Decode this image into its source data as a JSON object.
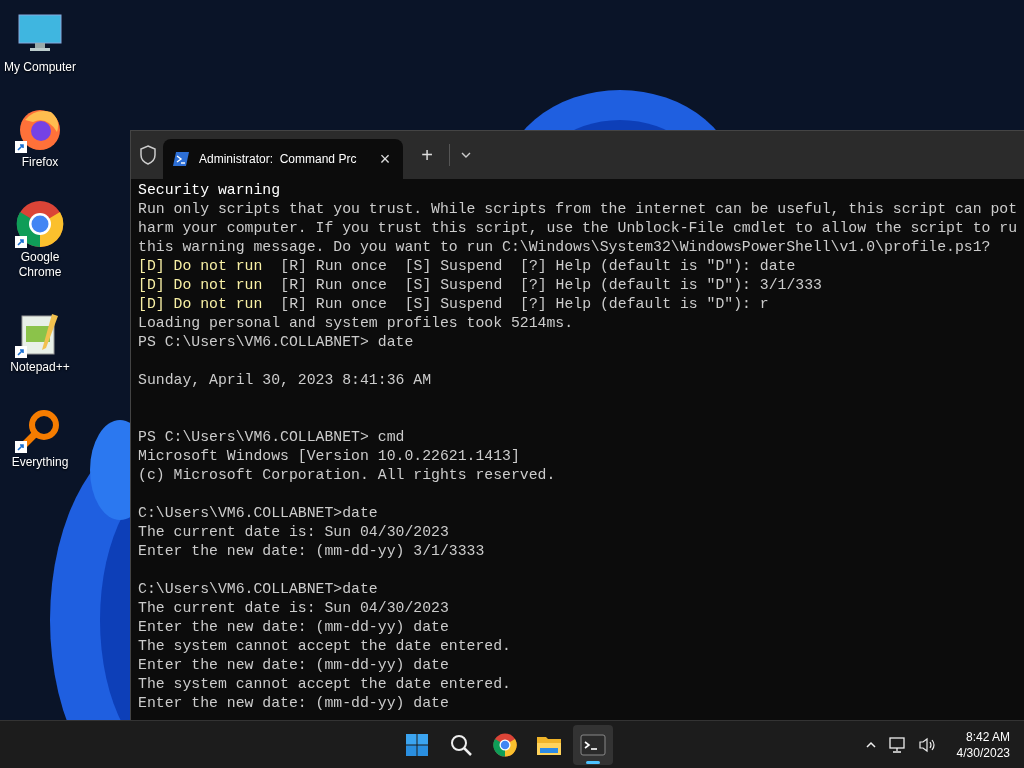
{
  "desktop_icons": [
    {
      "label": "My Computer",
      "kind": "monitor",
      "shortcut": false
    },
    {
      "label": "Firefox",
      "kind": "firefox",
      "shortcut": true
    },
    {
      "label": "Google Chrome",
      "kind": "chrome",
      "shortcut": true
    },
    {
      "label": "Notepad++",
      "kind": "notepad",
      "shortcut": true
    },
    {
      "label": "Everything",
      "kind": "everything",
      "shortcut": true
    }
  ],
  "terminal": {
    "tabs": [
      {
        "title": "Administrator:  Command Prc",
        "close": "×",
        "selected": true
      }
    ],
    "new_tab": "+",
    "lines": [
      {
        "kind": "heading",
        "text": "Security warning"
      },
      {
        "kind": "text",
        "text": "Run only scripts that you trust. While scripts from the internet can be useful, this script can pot"
      },
      {
        "kind": "text",
        "text": "harm your computer. If you trust this script, use the Unblock-File cmdlet to allow the script to ru"
      },
      {
        "kind": "text",
        "text": "this warning message. Do you want to run C:\\Windows\\System32\\WindowsPowerShell\\v1.0\\profile.ps1?"
      },
      {
        "kind": "choice",
        "option": "[D] Do not run",
        "rest": "[R] Run once  [S] Suspend  [?] Help (default is \"D\"): date"
      },
      {
        "kind": "choice",
        "option": "[D] Do not run",
        "rest": "[R] Run once  [S] Suspend  [?] Help (default is \"D\"): 3/1/333"
      },
      {
        "kind": "choice",
        "option": "[D] Do not run",
        "rest": "[R] Run once  [S] Suspend  [?] Help (default is \"D\"): r"
      },
      {
        "kind": "text",
        "text": "Loading personal and system profiles took 5214ms."
      },
      {
        "kind": "text",
        "text": "PS C:\\Users\\VM6.COLLABNET> date"
      },
      {
        "kind": "blank"
      },
      {
        "kind": "text",
        "text": "Sunday, April 30, 2023 8:41:36 AM"
      },
      {
        "kind": "blank"
      },
      {
        "kind": "blank"
      },
      {
        "kind": "text",
        "text": "PS C:\\Users\\VM6.COLLABNET> cmd"
      },
      {
        "kind": "text",
        "text": "Microsoft Windows [Version 10.0.22621.1413]"
      },
      {
        "kind": "text",
        "text": "(c) Microsoft Corporation. All rights reserved."
      },
      {
        "kind": "blank"
      },
      {
        "kind": "text",
        "text": "C:\\Users\\VM6.COLLABNET>date"
      },
      {
        "kind": "text",
        "text": "The current date is: Sun 04/30/2023"
      },
      {
        "kind": "text",
        "text": "Enter the new date: (mm-dd-yy) 3/1/3333"
      },
      {
        "kind": "blank"
      },
      {
        "kind": "text",
        "text": "C:\\Users\\VM6.COLLABNET>date"
      },
      {
        "kind": "text",
        "text": "The current date is: Sun 04/30/2023"
      },
      {
        "kind": "text",
        "text": "Enter the new date: (mm-dd-yy) date"
      },
      {
        "kind": "text",
        "text": "The system cannot accept the date entered."
      },
      {
        "kind": "text",
        "text": "Enter the new date: (mm-dd-yy) date"
      },
      {
        "kind": "text",
        "text": "The system cannot accept the date entered."
      },
      {
        "kind": "text",
        "text": "Enter the new date: (mm-dd-yy) date"
      }
    ]
  },
  "taskbar": {
    "apps": [
      {
        "kind": "start",
        "selected": false
      },
      {
        "kind": "search",
        "selected": false
      },
      {
        "kind": "chrome",
        "selected": false
      },
      {
        "kind": "folder",
        "selected": false
      },
      {
        "kind": "terminal",
        "selected": true
      }
    ],
    "time": "8:42 AM",
    "date": "4/30/2023"
  }
}
